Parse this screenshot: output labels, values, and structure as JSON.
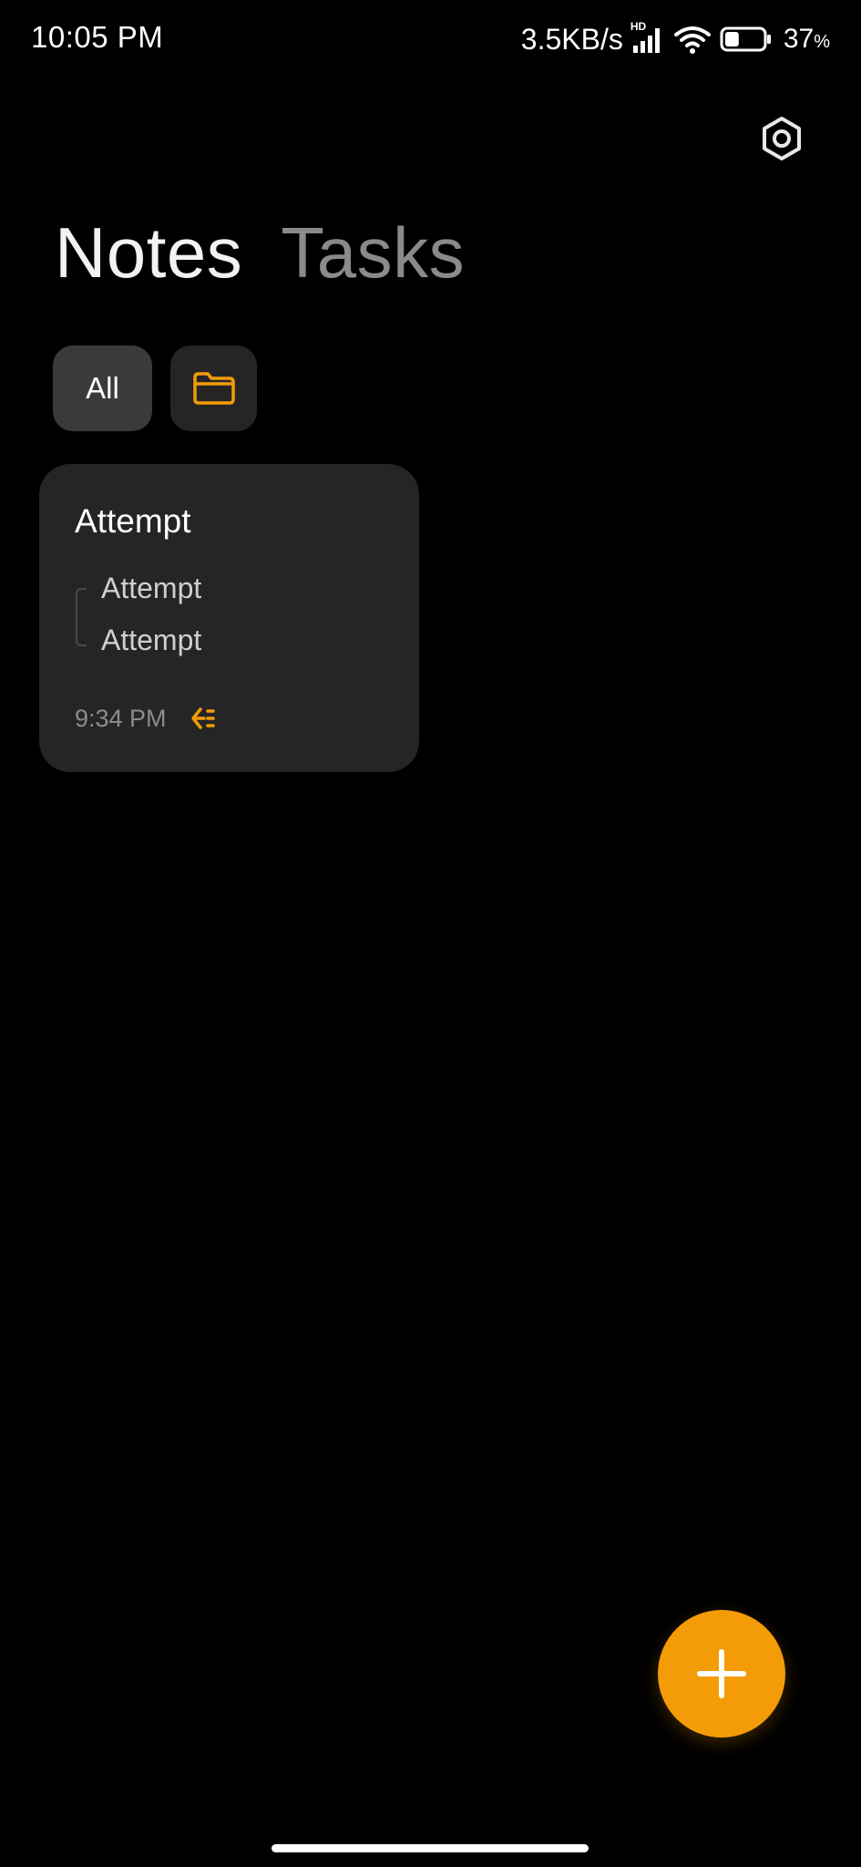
{
  "status_bar": {
    "time": "10:05 PM",
    "net_speed": "3.5KB/s",
    "signal_badge": "HD",
    "battery_percent": "37",
    "battery_symbol": "%",
    "battery_level": 0.37
  },
  "settings": {
    "icon": "settings-hexagon-icon"
  },
  "tabs": [
    {
      "label": "Notes",
      "active": true
    },
    {
      "label": "Tasks",
      "active": false
    }
  ],
  "filters": {
    "all_label": "All",
    "folder_icon": "folder-icon"
  },
  "notes": [
    {
      "title": "Attempt",
      "lines": [
        "Attempt",
        "Attempt"
      ],
      "time": "9:34 PM",
      "type_icon": "checklist-icon"
    }
  ],
  "fab": {
    "icon": "plus-icon"
  },
  "colors": {
    "accent": "#f39c07",
    "background": "#000000",
    "card": "#252525",
    "chip_active": "#3a3a3a"
  }
}
